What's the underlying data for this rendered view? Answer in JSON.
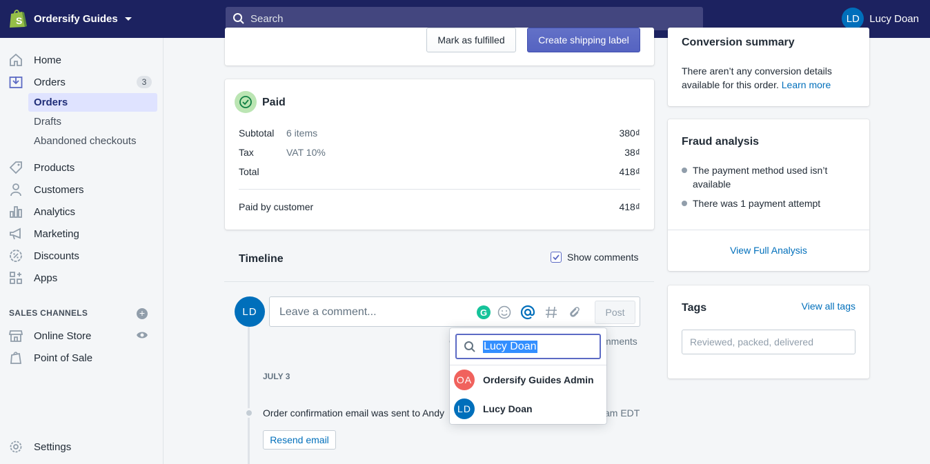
{
  "topbar": {
    "store_name": "Ordersify Guides",
    "search_placeholder": "Search",
    "user_initials": "LD",
    "user_name": "Lucy Doan",
    "brand_color": "#1c2260"
  },
  "sidebar": {
    "items": [
      {
        "label": "Home",
        "icon": "home-icon"
      },
      {
        "label": "Orders",
        "icon": "orders-icon",
        "badge": "3"
      },
      {
        "label": "Products",
        "icon": "tag-icon"
      },
      {
        "label": "Customers",
        "icon": "person-icon"
      },
      {
        "label": "Analytics",
        "icon": "bar-chart-icon"
      },
      {
        "label": "Marketing",
        "icon": "megaphone-icon"
      },
      {
        "label": "Discounts",
        "icon": "discount-icon"
      },
      {
        "label": "Apps",
        "icon": "apps-icon"
      }
    ],
    "order_subitems": [
      "Orders",
      "Drafts",
      "Abandoned checkouts"
    ],
    "sales_channels_heading": "SALES CHANNELS",
    "channels": [
      {
        "label": "Online Store",
        "icon": "store-icon"
      },
      {
        "label": "Point of Sale",
        "icon": "pos-icon"
      }
    ],
    "settings_label": "Settings"
  },
  "fulfillment": {
    "mark_fulfilled_label": "Mark as fulfilled",
    "create_label_label": "Create shipping label"
  },
  "payment": {
    "status": "Paid",
    "rows": [
      {
        "label": "Subtotal",
        "detail": "6 items",
        "value": "380₫"
      },
      {
        "label": "Tax",
        "detail": "VAT 10%",
        "value": "38₫"
      },
      {
        "label": "Total",
        "detail": "",
        "value": "418₫"
      }
    ],
    "paid_by_label": "Paid by customer",
    "paid_by_value": "418₫"
  },
  "timeline": {
    "title": "Timeline",
    "show_comments_label": "Show comments",
    "show_comments_checked": true,
    "commenter_initials": "LD",
    "comment_placeholder": "Leave a comment...",
    "post_label": "Post",
    "behind_left": "O",
    "behind_right": "mments",
    "date_heading": "JULY 3",
    "event_text": "Order confirmation email was sent to Andy",
    "event_time_fragment": "am EDT",
    "resend_label": "Resend email"
  },
  "mention_popup": {
    "query": "Lucy Doan",
    "results": [
      {
        "initials": "OA",
        "name": "Ordersify Guides Admin",
        "color": "#f0625d"
      },
      {
        "initials": "LD",
        "name": "Lucy Doan",
        "color": "#006fbb"
      }
    ]
  },
  "conversion": {
    "title": "Conversion summary",
    "text": "There aren’t any conversion details available for this order.",
    "link": "Learn more"
  },
  "fraud": {
    "title": "Fraud analysis",
    "items": [
      "The payment method used isn’t available",
      "There was 1 payment attempt"
    ],
    "view_link": "View Full Analysis"
  },
  "tags": {
    "title": "Tags",
    "view_all_link": "View all tags",
    "input_placeholder": "Reviewed, packed, delivered"
  }
}
